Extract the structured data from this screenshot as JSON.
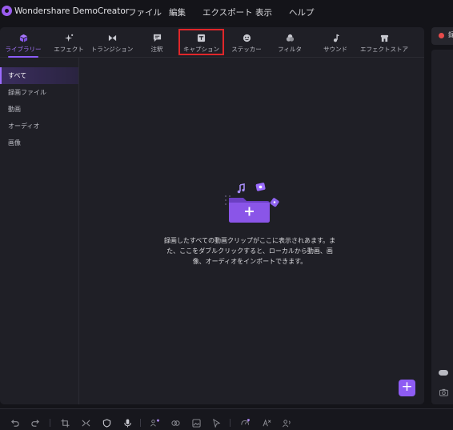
{
  "app": {
    "title": "Wondershare DemoCreator"
  },
  "menu": [
    "ファイル",
    "編集",
    "エクスポート",
    "表示",
    "ヘルプ"
  ],
  "tabs": [
    {
      "label": "ライブラリー",
      "icon": "cube-icon",
      "active": true
    },
    {
      "label": "エフェクト",
      "icon": "sparkle-icon"
    },
    {
      "label": "トランジション",
      "icon": "transition-icon"
    },
    {
      "label": "注釈",
      "icon": "annotation-icon"
    },
    {
      "label": "キャプション",
      "icon": "caption-icon",
      "highlighted": true
    },
    {
      "label": "ステッカー",
      "icon": "sticker-icon"
    },
    {
      "label": "フィルタ",
      "icon": "filter-icon"
    },
    {
      "label": "サウンド",
      "icon": "music-note-icon"
    },
    {
      "label": "エフェクトストア",
      "icon": "store-icon"
    }
  ],
  "sidebar": {
    "items": [
      {
        "label": "すべて",
        "active": true
      },
      {
        "label": "録画ファイル"
      },
      {
        "label": "動画"
      },
      {
        "label": "オーディオ"
      },
      {
        "label": "画像"
      }
    ]
  },
  "empty_state": {
    "message": "録画したすべての動画クリップがここに表示されあます。また、ここをダブルクリックすると、ローカルから動画、画像、オーディオをインポートできます。"
  },
  "add_button": {
    "label": "+"
  },
  "preview": {
    "record_label": "録"
  },
  "colors": {
    "accent": "#8b5cf6",
    "highlight_box": "#e0262a",
    "background": "#141419",
    "panel": "#1f1f26"
  }
}
